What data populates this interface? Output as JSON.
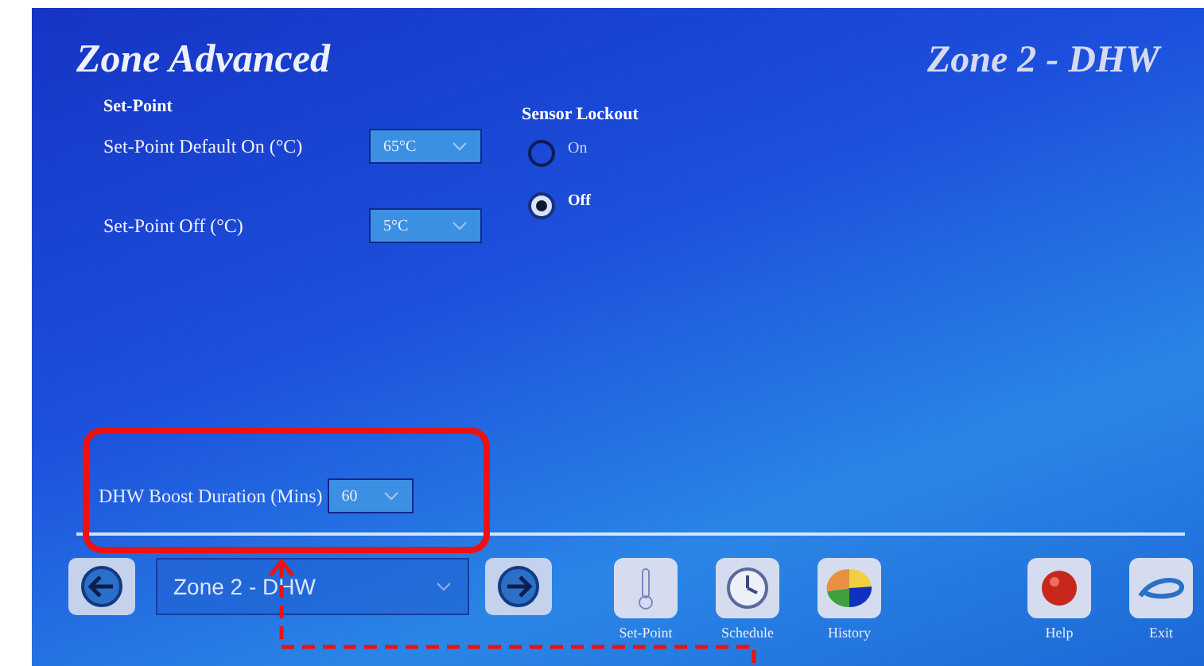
{
  "header": {
    "title": "Zone Advanced",
    "zone": "Zone 2 - DHW"
  },
  "setpoint": {
    "heading": "Set-Point",
    "fields": [
      {
        "label": "Set-Point Default On (°C)",
        "value": "65°C"
      },
      {
        "label": "Set-Point Off (°C)",
        "value": "5°C"
      }
    ]
  },
  "sensor_lockout": {
    "heading": "Sensor Lockout",
    "options": [
      {
        "label": "On",
        "selected": false
      },
      {
        "label": "Off",
        "selected": true
      }
    ]
  },
  "boost": {
    "label": "DHW Boost Duration (Mins)",
    "value": "60"
  },
  "nav": {
    "zone": "Zone 2 - DHW"
  },
  "toolbar": [
    {
      "kind": "setpoint",
      "label": "Set-Point"
    },
    {
      "kind": "schedule",
      "label": "Schedule"
    },
    {
      "kind": "history",
      "label": "History"
    },
    {
      "kind": "help",
      "label": "Help"
    },
    {
      "kind": "exit",
      "label": "Exit"
    }
  ]
}
